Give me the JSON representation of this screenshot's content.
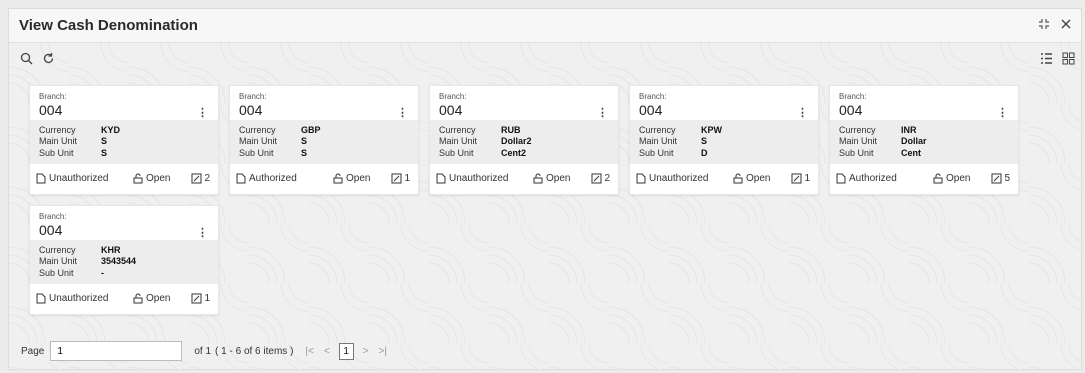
{
  "window": {
    "title": "View Cash Denomination"
  },
  "labels": {
    "branch": "Branch:",
    "currency": "Currency",
    "main_unit": "Main Unit",
    "sub_unit": "Sub Unit",
    "open": "Open"
  },
  "cards": [
    {
      "branch": "004",
      "currency": "KYD",
      "main_unit": "S",
      "sub_unit": "S",
      "status": "Unauthorized",
      "version": "2"
    },
    {
      "branch": "004",
      "currency": "GBP",
      "main_unit": "S",
      "sub_unit": "S",
      "status": "Authorized",
      "version": "1"
    },
    {
      "branch": "004",
      "currency": "RUB",
      "main_unit": "Dollar2",
      "sub_unit": "Cent2",
      "status": "Unauthorized",
      "version": "2"
    },
    {
      "branch": "004",
      "currency": "KPW",
      "main_unit": "S",
      "sub_unit": "D",
      "status": "Unauthorized",
      "version": "1"
    },
    {
      "branch": "004",
      "currency": "INR",
      "main_unit": "Dollar",
      "sub_unit": "Cent",
      "status": "Authorized",
      "version": "5"
    },
    {
      "branch": "004",
      "currency": "KHR",
      "main_unit": "3543544",
      "sub_unit": "-",
      "status": "Unauthorized",
      "version": "1"
    }
  ],
  "pager": {
    "label": "Page",
    "value": "1",
    "of": "of 1",
    "items": "( 1 - 6 of 6 items )",
    "current": "1"
  },
  "icons": [
    "search-icon",
    "refresh-icon",
    "minimize-icon",
    "close-icon",
    "list-view-icon",
    "grid-view-icon",
    "kebab-menu-icon",
    "document-icon",
    "unlock-icon",
    "edit-icon"
  ]
}
